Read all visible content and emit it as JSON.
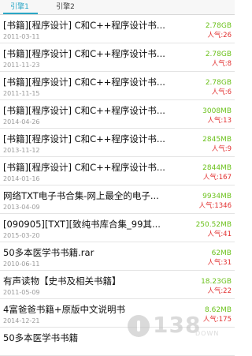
{
  "tabs": [
    {
      "label": "引擎1"
    },
    {
      "label": "引擎2"
    }
  ],
  "list": [
    {
      "title": "[书籍][程序设计] C和C++程序设计书...",
      "date": "2011-03-11",
      "size": "2.78GB",
      "popularity": "人气:26"
    },
    {
      "title": "[书籍][程序设计] C和C++程序设计书...",
      "date": "2011-11-23",
      "size": "2.78GB",
      "popularity": "人气:8"
    },
    {
      "title": "[书籍][程序设计] C和C++程序设计书...",
      "date": "2011-11-15",
      "size": "2.78GB",
      "popularity": "人气:6"
    },
    {
      "title": "[书籍][程序设计] C和C++程序设计书...",
      "date": "2014-04-26",
      "size": "3008MB",
      "popularity": "人气:13"
    },
    {
      "title": "[书籍][程序设计] C和C++程序设计书...",
      "date": "2013-11-12",
      "size": "2845MB",
      "popularity": "人气:9"
    },
    {
      "title": "[书籍][程序设计] C和C++程序设计书...",
      "date": "2014-01-16",
      "size": "2844MB",
      "popularity": "人气:167"
    },
    {
      "title": "网络TXT电子书合集-网上最全的电子...",
      "date": "2013-04-09",
      "size": "9934MB",
      "popularity": "人气:1346"
    },
    {
      "title": "[090905][TXT][致纯书库合集_99其...",
      "date": "2015-03-20",
      "size": "250.52MB",
      "popularity": "人气:41"
    },
    {
      "title": "50多本医学书书籍.rar",
      "date": "2010-06-11",
      "size": "62MB",
      "popularity": "人气:31"
    },
    {
      "title": "有声读物【史书及相关书籍】",
      "date": "2011-05-09",
      "size": "18.23GB",
      "popularity": "人气:22"
    },
    {
      "title": "4富爸爸书籍+原版中文说明书",
      "date": "2014-12-21",
      "size": "8.62MB",
      "popularity": "人气:175"
    },
    {
      "title": "50多本医学书书籍",
      "date": "",
      "size": "",
      "popularity": ""
    }
  ],
  "watermark": {
    "number": "138",
    "text": "DOWN"
  }
}
